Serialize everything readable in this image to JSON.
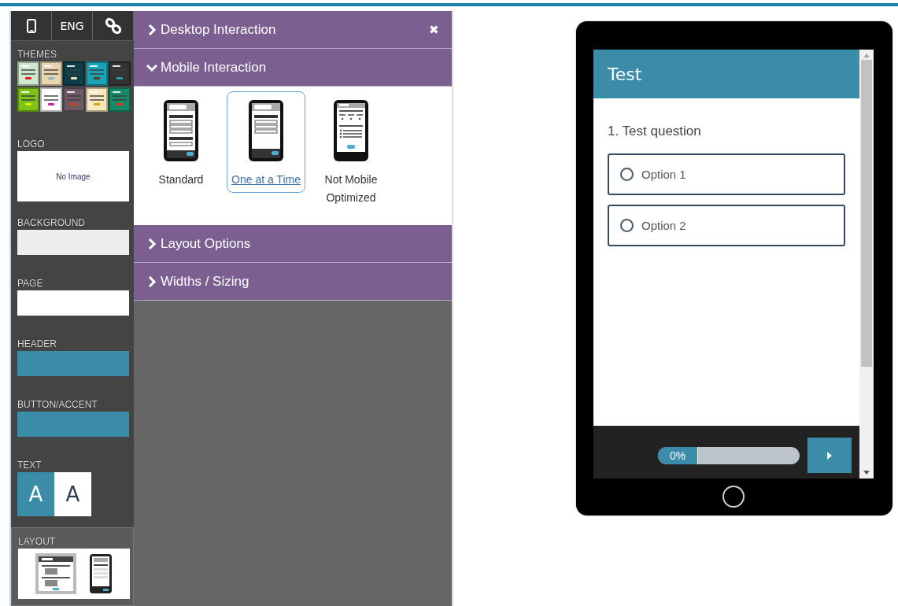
{
  "toolbar": [
    {
      "kind": "phone"
    },
    {
      "kind": "text",
      "label": "ENG"
    },
    {
      "kind": "link"
    }
  ],
  "sidebar": [
    {
      "kind": "themes",
      "label": "THEMES",
      "themes": [
        {
          "color": "#cfe8cf",
          "button": {
            "color": "#e02020"
          }
        },
        {
          "color": "#e9d4b0",
          "button": {
            "color": "#8ab8c0"
          }
        },
        {
          "color": "#0e3d4a",
          "button": {
            "color": "#f0e0c0"
          }
        },
        {
          "color": "#1aa3b5",
          "button": {
            "color": "#5a3a2a"
          }
        },
        {
          "color": "#333333",
          "button": {
            "color": "#1aa3b5"
          }
        },
        {
          "color": "#7fc21a",
          "button": {
            "color": "#d8f000"
          }
        },
        {
          "color": "#ffffff",
          "button": {
            "color": "#d020a0"
          }
        },
        {
          "color": "#6e5a66",
          "button": {
            "color": "#e04010"
          }
        },
        {
          "color": "#f7e8c0",
          "button": {
            "color": "#e0a000"
          }
        },
        {
          "color": "#178a6a",
          "button": {
            "color": "#e03020"
          }
        }
      ]
    },
    {
      "kind": "logo",
      "label": "LOGO",
      "text": "No Image"
    },
    {
      "kind": "swatch",
      "label": "BACKGROUND",
      "color": "#eeeeee"
    },
    {
      "kind": "swatch",
      "label": "PAGE",
      "color": "#ffffff"
    },
    {
      "kind": "swatch",
      "label": "HEADER",
      "color": "#3a8ca8"
    },
    {
      "kind": "swatch",
      "label": "BUTTON/ACCENT",
      "color": "#3a8ca8"
    },
    {
      "kind": "text",
      "label": "TEXT",
      "options": [
        {
          "letter": "A",
          "color": "#3a8ca8"
        },
        {
          "letter": "A",
          "color": "#ffffff"
        }
      ]
    },
    {
      "kind": "layout",
      "label": "LAYOUT",
      "selected": true
    }
  ],
  "panel": {
    "sections": [
      {
        "title": "Desktop Interaction",
        "expanded": false,
        "close_glyph": "✖"
      },
      {
        "title": "Mobile Interaction",
        "expanded": true,
        "options": [
          {
            "kind": "standard",
            "label": "Standard",
            "selected": false
          },
          {
            "kind": "one_at_a_time",
            "label": "One at a Time",
            "selected": true
          },
          {
            "kind": "not_optimized",
            "label": "Not Mobile Optimized",
            "selected": false
          }
        ]
      },
      {
        "title": "Layout Options",
        "expanded": false
      },
      {
        "title": "Widths / Sizing",
        "expanded": false
      }
    ]
  },
  "preview": {
    "header": "Test",
    "question": "1. Test question",
    "answers": [
      {
        "label": "Option 1",
        "selected": false
      },
      {
        "label": "Option 2",
        "selected": false
      }
    ],
    "progress": {
      "label": "0%"
    }
  }
}
